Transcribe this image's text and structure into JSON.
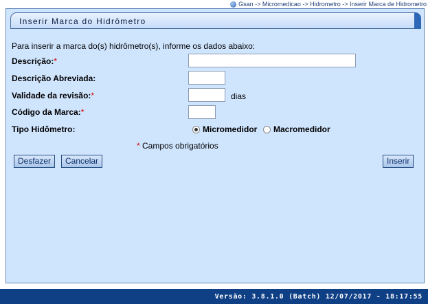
{
  "breadcrumb": "Gsan -> Micromedicao -> Hidrometro -> Inserir Marca de Hidrometro",
  "title": "Inserir Marca do Hidrômetro",
  "intro": "Para inserir a marca do(s) hidrômetro(s), informe os dados abaixo:",
  "form": {
    "descricao": {
      "label": "Descrição:",
      "required": "*",
      "value": ""
    },
    "descricao_abreviada": {
      "label": "Descrição Abreviada:",
      "value": ""
    },
    "validade": {
      "label": "Validade da revisão:",
      "required": "*",
      "value": "",
      "suffix": "dias"
    },
    "codigo": {
      "label": "Código da Marca:",
      "required": "*",
      "value": ""
    },
    "tipo": {
      "label": "Tipo Hidômetro:",
      "options": [
        "Micromedidor",
        "Macromedidor"
      ],
      "selected": "Micromedidor"
    }
  },
  "legend": {
    "star": "*",
    "text": " Campos obrigatórios"
  },
  "buttons": {
    "desfazer": "Desfazer",
    "cancelar": "Cancelar",
    "inserir": "Inserir"
  },
  "footer": "Versão: 3.8.1.0 (Batch) 12/07/2017 - 18:17:55"
}
